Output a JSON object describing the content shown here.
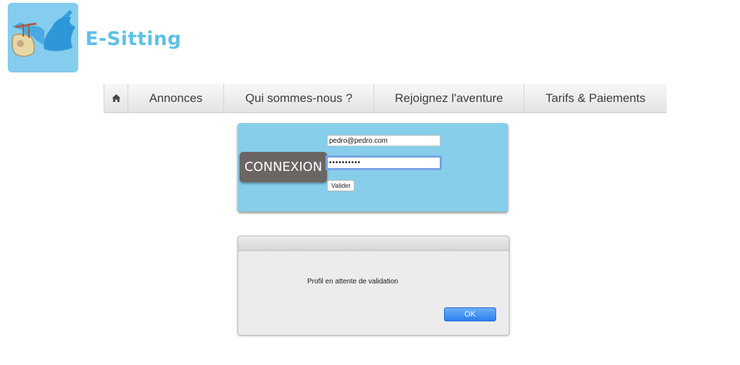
{
  "brand": {
    "name": "E-Sitting",
    "logo_icon": "stork-carrying-baby-icon",
    "colors": {
      "logo_bg": "#84cdee",
      "name": "#5fc0e6"
    }
  },
  "nav": {
    "home_icon": "home-icon",
    "items": [
      {
        "label": "Annonces"
      },
      {
        "label": "Qui sommes-nous ?"
      },
      {
        "label": "Rejoignez l'aventure"
      },
      {
        "label": "Tarifs & Paiements"
      }
    ]
  },
  "login": {
    "title": "CONNEXION",
    "email_value": "pedro@pedro.com",
    "password_value": "••••••••••",
    "submit_label": "Valider",
    "colors": {
      "panel_bg": "#87ceeb",
      "badge_bg": "#6b6663"
    }
  },
  "dialog": {
    "message": "Profil en attente de validation",
    "ok_label": "OK",
    "colors": {
      "ok_button": "#3a8cf2"
    }
  }
}
